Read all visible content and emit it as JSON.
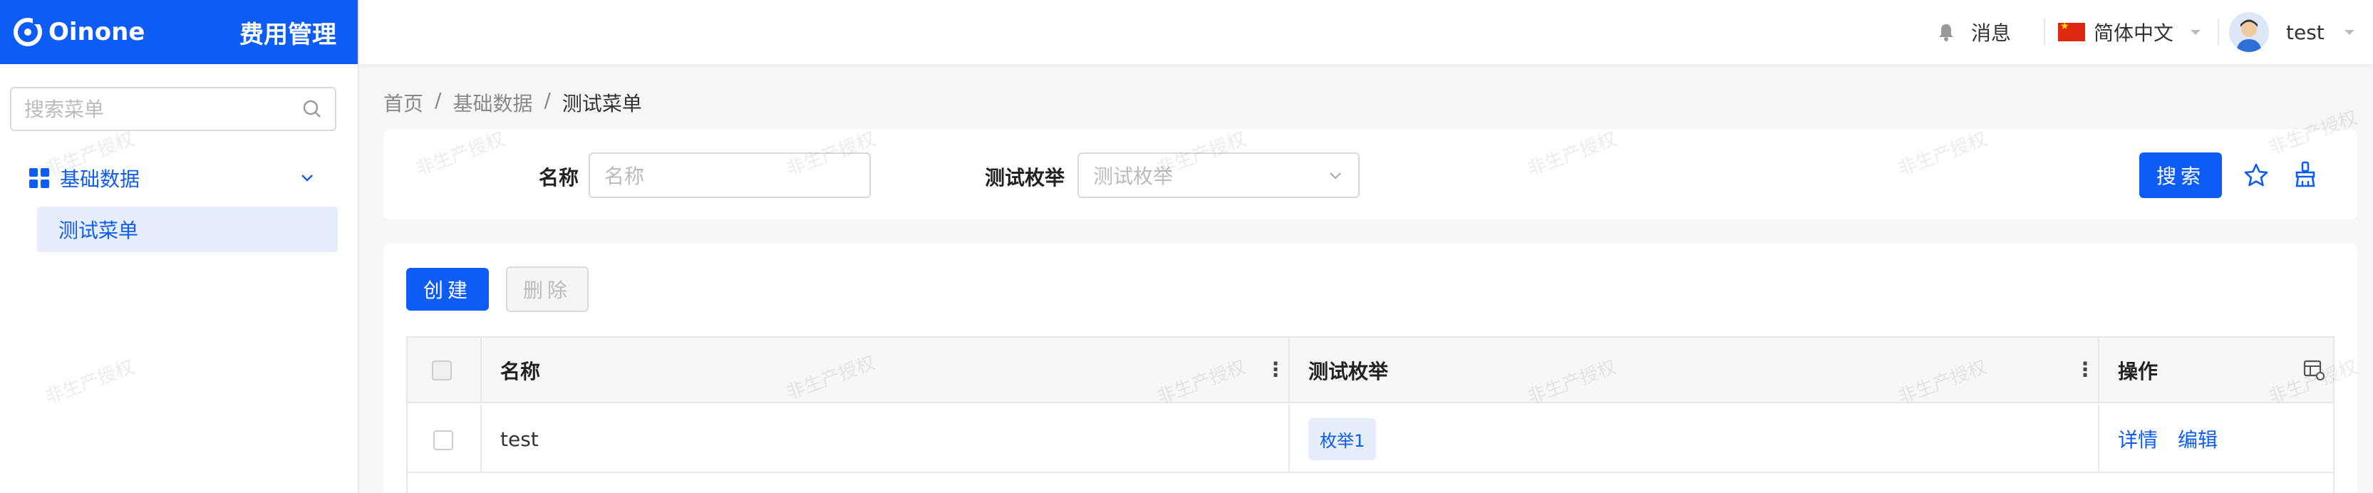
{
  "brand": {
    "name": "Oinone",
    "module": "费用管理"
  },
  "sidebar": {
    "search_placeholder": "搜索菜单",
    "group_label": "基础数据",
    "items": [
      {
        "label": "测试菜单"
      }
    ]
  },
  "topbar": {
    "messages_label": "消息",
    "language_label": "简体中文",
    "user_name": "test"
  },
  "breadcrumb": {
    "home": "首页",
    "sep": "/",
    "level1": "基础数据",
    "current": "测试菜单"
  },
  "filters": {
    "name_label": "名称",
    "name_placeholder": "名称",
    "enum_label": "测试枚举",
    "enum_placeholder": "测试枚举",
    "search_button": "搜索"
  },
  "toolbar": {
    "create_button": "创建",
    "delete_button": "删除"
  },
  "table": {
    "columns": [
      "名称",
      "测试枚举",
      "操作"
    ],
    "rows": [
      {
        "name": "test",
        "enum": "枚举1",
        "actions": [
          "详情",
          "编辑"
        ]
      }
    ]
  },
  "watermark": "非生产授权",
  "colors": {
    "primary": "#0d5cf5"
  }
}
